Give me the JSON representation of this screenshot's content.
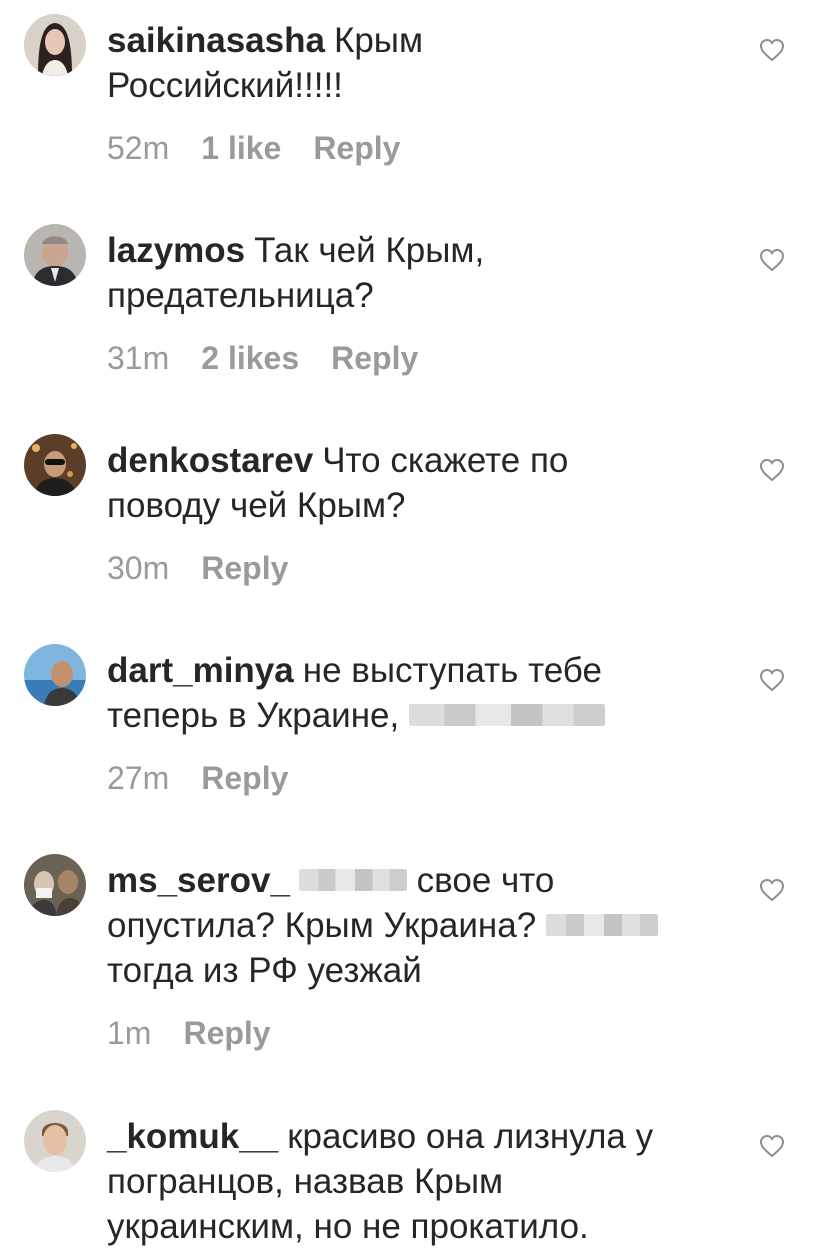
{
  "comments": [
    {
      "username": "saikinasasha",
      "lines": [
        "Крым",
        "Российский!!!!!"
      ],
      "time": "52m",
      "likes": "1 like",
      "reply": "Reply",
      "avatar": "avatar-woman-long-hair"
    },
    {
      "username": "lazymos",
      "lines": [
        "Так чей Крым,",
        "предательница?"
      ],
      "time": "31m",
      "likes": "2 likes",
      "reply": "Reply",
      "avatar": "avatar-man-suit"
    },
    {
      "username": "denkostarev",
      "lines": [
        "Что скажете по",
        "поводу чей Крым?"
      ],
      "time": "30m",
      "likes": "",
      "reply": "Reply",
      "avatar": "avatar-man-sunglasses"
    },
    {
      "username": "dart_minya",
      "lines": [
        "не выступать тебе",
        "теперь в Украине,"
      ],
      "time": "27m",
      "likes": "",
      "reply": "Reply",
      "avatar": "avatar-man-seaside"
    },
    {
      "username": "ms_serov_",
      "lines": [
        "свое что",
        "опустила? Крым Украина?",
        "тогда из РФ уезжай"
      ],
      "time": "1m",
      "likes": "",
      "reply": "Reply",
      "avatar": "avatar-group-photo"
    },
    {
      "username": "_komuk__",
      "lines": [
        "красиво она лизнула у",
        "погранцов, назвав Крым",
        "украинским, но не прокатило."
      ],
      "time": "",
      "likes": "",
      "reply": "",
      "avatar": "avatar-young-man"
    }
  ],
  "icons": {
    "like": "heart-outline-icon"
  },
  "colors": {
    "text": "#262626",
    "meta": "#9a9a9a",
    "heart": "#8e8e8e"
  }
}
